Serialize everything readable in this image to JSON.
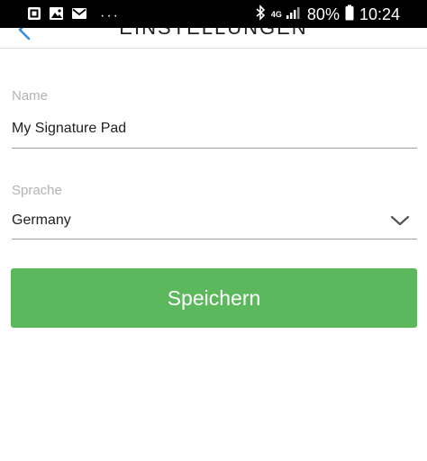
{
  "status_bar": {
    "left_icons": [
      "screenshot-notification-icon",
      "image-notification-icon",
      "mail-notification-icon"
    ],
    "more": "···",
    "network": "4G",
    "battery": "80%",
    "time": "10:24"
  },
  "app_bar": {
    "title": "EINSTELLUNGEN"
  },
  "form": {
    "name": {
      "label": "Name",
      "value": "My Signature Pad"
    },
    "language": {
      "label": "Sprache",
      "value": "Germany"
    },
    "save_label": "Speichern"
  },
  "colors": {
    "primary_button": "#5cb85c",
    "status_bar": "#000000",
    "back_icon": "#3b8ed6"
  }
}
